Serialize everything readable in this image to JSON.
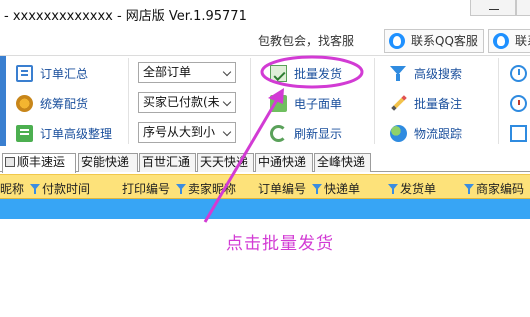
{
  "window": {
    "title": "- xxxxxxxxxxxxx - 网店版 Ver.1.95771"
  },
  "service": {
    "text": "包教包会，找客服",
    "qq_buttons": [
      "联系QQ客服",
      "联系"
    ]
  },
  "toolbar": {
    "col1": [
      "订单汇总",
      "统筹配货",
      "订单高级整理"
    ],
    "selects": [
      "全部订单",
      "买家已付款(未",
      "序号从大到小"
    ],
    "col3": [
      "批量发货",
      "电子面单",
      "刷新显示"
    ],
    "col4": [
      "高级搜索",
      "批量备注",
      "物流跟踪"
    ]
  },
  "tabs": [
    "顺丰速运",
    "安能快递",
    "百世汇通",
    "天天快递",
    "中通快递",
    "全峰快递"
  ],
  "columns": [
    "昵称",
    "付款时间",
    "打印编号",
    "卖家昵称",
    "订单编号",
    "快递单",
    "发货单",
    "商家编码"
  ],
  "annotation": {
    "text": "点击批量发货",
    "color": "#d23bd4"
  },
  "colors": {
    "header_yellow": "#fde27a",
    "selected_row_blue": "#37a5f5",
    "link_blue": "#1a4f9c"
  }
}
